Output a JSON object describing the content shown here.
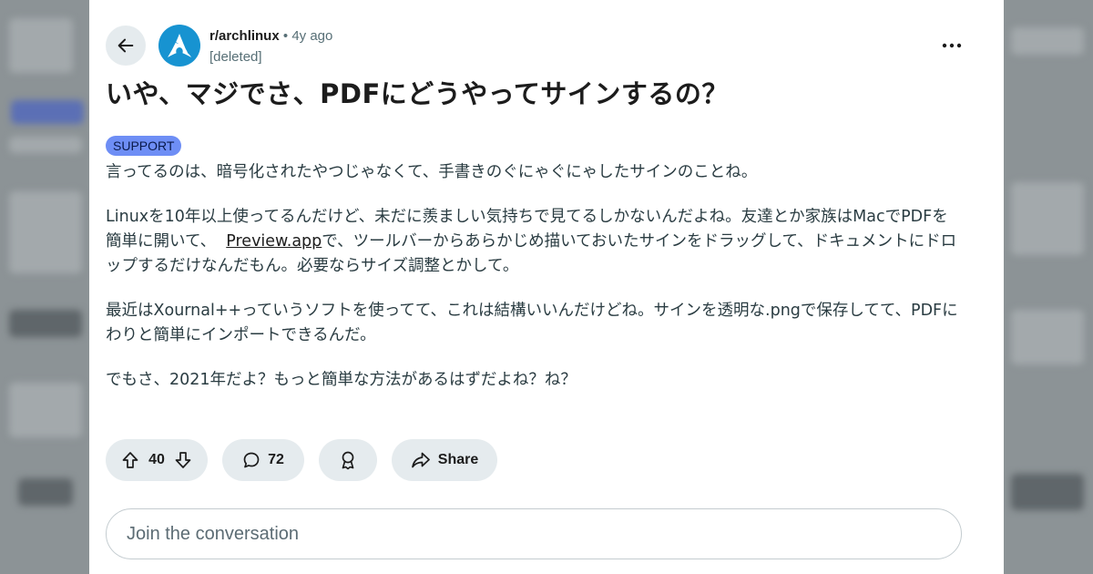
{
  "post": {
    "subreddit": "r/archlinux",
    "separator": "•",
    "age": "4y ago",
    "author": "[deleted]",
    "title": "いや、マジでさ、PDFにどうやってサインするの？",
    "flair": "SUPPORT",
    "body": {
      "p1": "言ってるのは、暗号化されたやつじゃなくて、手書きのぐにゃぐにゃしたサインのことね。",
      "p2_a": "Linuxを10年以上使ってるんだけど、未だに羨ましい気持ちで見てるしかないんだよね。友達とか家族はMacでPDFを簡単に開いて、",
      "p2_link": "Preview.app",
      "p2_b": "で、ツールバーからあらかじめ描いておいたサインをドラッグして、ドキュメントにドロップするだけなんだもん。必要ならサイズ調整とかして。",
      "p3": "最近はXournal++っていうソフトを使ってて、これは結構いいんだけどね。サインを透明な.pngで保存してて、PDFにわりと簡単にインポートできるんだ。",
      "p4": "でもさ、2021年だよ？もっと簡単な方法があるはずだよね？ね？"
    }
  },
  "actions": {
    "votes": "40",
    "comments": "72",
    "share_label": "Share"
  },
  "comment_input": {
    "placeholder": "Join the conversation"
  },
  "icons": {
    "back": "arrow-left-icon",
    "avatar": "arch-linux-logo",
    "more": "more-horizontal-icon",
    "upvote": "upvote-arrow-icon",
    "downvote": "downvote-arrow-icon",
    "comment": "comment-bubble-icon",
    "award": "award-icon",
    "share": "share-arrow-icon"
  },
  "colors": {
    "flair_bg": "#6e8ef5",
    "arch_blue": "#1793d1",
    "pill_bg": "#e5ebee"
  }
}
